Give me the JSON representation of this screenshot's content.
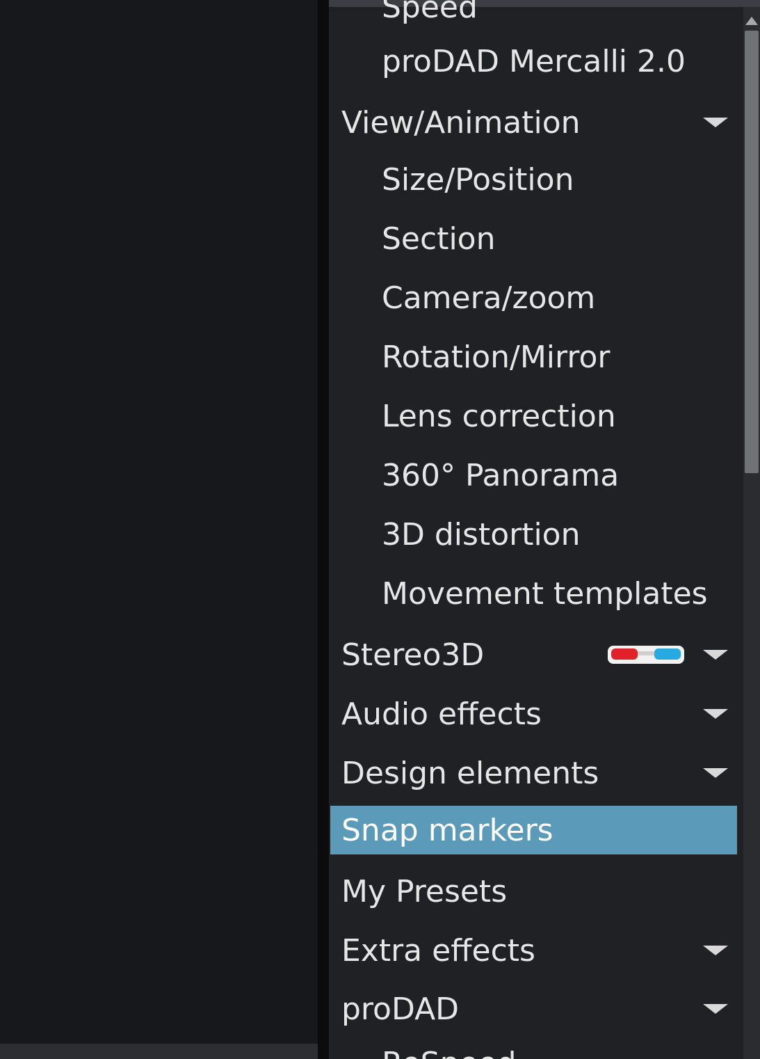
{
  "effects_menu": {
    "items": [
      {
        "label": "Speed",
        "type": "sub",
        "partial": true
      },
      {
        "label": "proDAD Mercalli 2.0",
        "type": "sub"
      },
      {
        "label": "View/Animation",
        "type": "category",
        "expanded": true
      },
      {
        "label": "Size/Position",
        "type": "sub"
      },
      {
        "label": "Section",
        "type": "sub"
      },
      {
        "label": "Camera/zoom",
        "type": "sub"
      },
      {
        "label": "Rotation/Mirror",
        "type": "sub"
      },
      {
        "label": "Lens correction",
        "type": "sub"
      },
      {
        "label": "360° Panorama",
        "type": "sub"
      },
      {
        "label": "3D distortion",
        "type": "sub"
      },
      {
        "label": "Movement templates",
        "type": "sub"
      },
      {
        "label": "Stereo3D",
        "type": "category",
        "icon": "anaglyph-glasses-icon"
      },
      {
        "label": "Audio effects",
        "type": "category"
      },
      {
        "label": "Design elements",
        "type": "category"
      },
      {
        "label": "Snap markers",
        "type": "item",
        "selected": true
      },
      {
        "label": "My Presets",
        "type": "item"
      },
      {
        "label": "Extra effects",
        "type": "category"
      },
      {
        "label": "proDAD",
        "type": "category"
      },
      {
        "label": "ReSpeed",
        "type": "sub",
        "partial": true
      }
    ]
  },
  "colors": {
    "panel_background": "#1f2124",
    "selected_background": "#5b9ab8",
    "text": "#e6e6e6",
    "glasses_red": "#e0222a",
    "glasses_cyan": "#27a9e1"
  },
  "scrollbar": {
    "position_fraction": 0.0,
    "visible_fraction": 0.42
  }
}
